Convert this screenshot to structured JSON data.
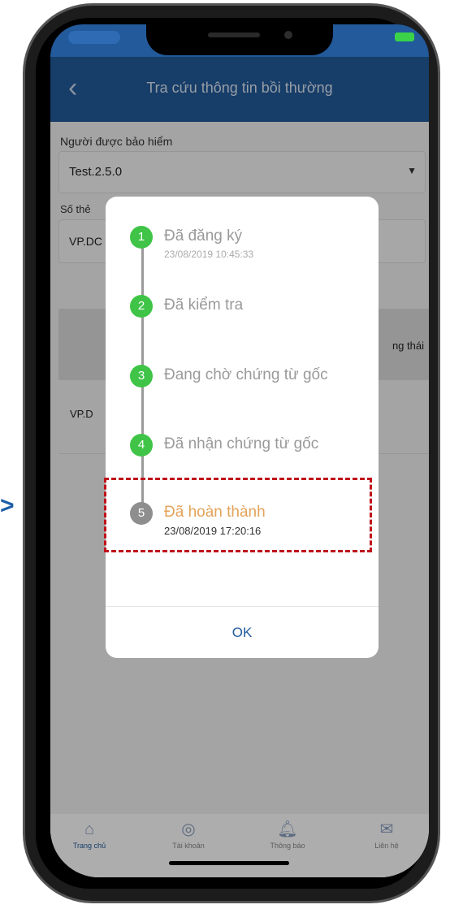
{
  "header": {
    "title": "Tra cứu thông tin bồi thường",
    "back_icon": "chevron-left-icon"
  },
  "form": {
    "insured_label": "Người được bảo hiểm",
    "insured_value": "Test.2.5.0",
    "card_label": "Số thẻ",
    "card_value": "VP.DC"
  },
  "table": {
    "status_header": "ng thái",
    "row_value": "VP.D"
  },
  "dialog": {
    "steps": [
      {
        "number": "1",
        "title": "Đã đăng ký",
        "time": "23/08/2019 10:45:33",
        "done": true
      },
      {
        "number": "2",
        "title": "Đã kiểm tra",
        "time": "",
        "done": true
      },
      {
        "number": "3",
        "title": "Đang chờ chứng từ gốc",
        "time": "",
        "done": true
      },
      {
        "number": "4",
        "title": "Đã nhận chứng từ gốc",
        "time": "",
        "done": true
      },
      {
        "number": "5",
        "title": "Đã hoàn thành",
        "time": "23/08/2019 17:20:16",
        "done": false
      }
    ],
    "ok_label": "OK"
  },
  "tabbar": {
    "tabs": [
      {
        "label": "Trang chủ",
        "icon": "home-icon"
      },
      {
        "label": "Tài khoản",
        "icon": "account-icon"
      },
      {
        "label": "Thông báo",
        "icon": "bell-icon"
      },
      {
        "label": "Liên hệ",
        "icon": "contact-icon"
      }
    ]
  },
  "annotation": {
    "arrow": ">"
  },
  "colors": {
    "primary": "#225a9b",
    "step_done": "#3fc447",
    "step_current": "#8e8e8e",
    "highlight": "#c0141c",
    "completed_text": "#e3a35a"
  }
}
